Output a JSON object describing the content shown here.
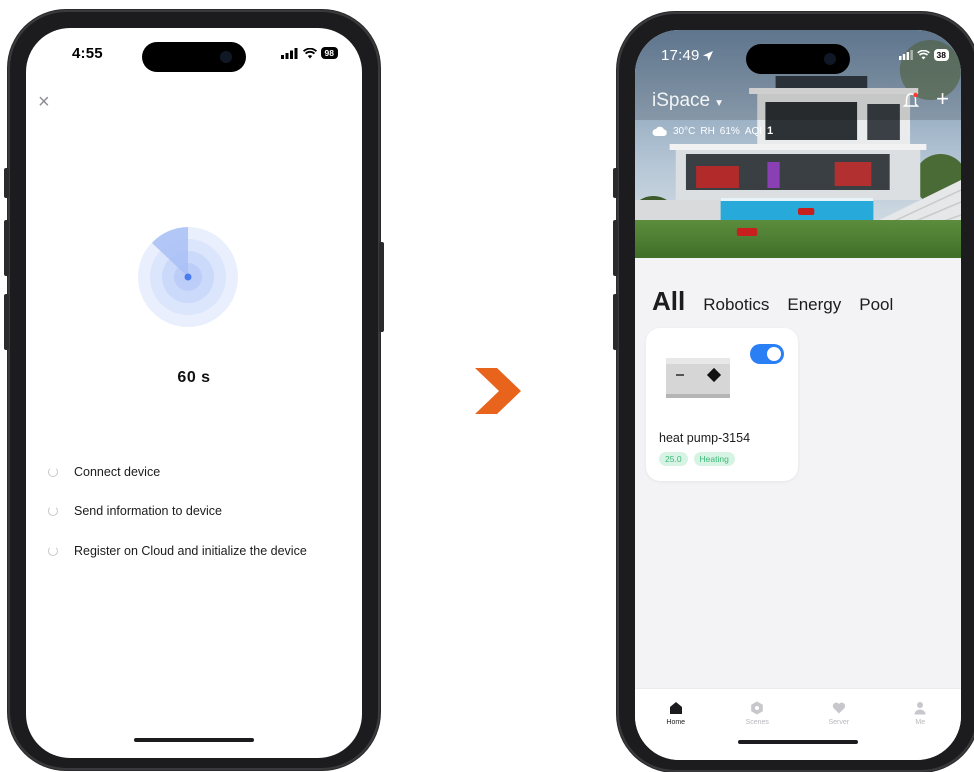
{
  "left_phone": {
    "status": {
      "time": "4:55",
      "battery": "98"
    },
    "close_symbol": "×",
    "countdown": "60 s",
    "steps": [
      {
        "label": "Connect device"
      },
      {
        "label": "Send information to device"
      },
      {
        "label": "Register on Cloud and initialize the device"
      }
    ]
  },
  "arrow_color": "#e8631c",
  "right_phone": {
    "status": {
      "time": "17:49",
      "battery": "38"
    },
    "space_title": "iSpace",
    "weather": {
      "temp": "30°C",
      "rh_label": "RH",
      "rh_value": "61%",
      "aqi_label": "AQI",
      "aqi_value": "1"
    },
    "plus_symbol": "+",
    "tabs": [
      {
        "label": "All",
        "active": true
      },
      {
        "label": "Robotics"
      },
      {
        "label": "Energy"
      },
      {
        "label": "Pool"
      }
    ],
    "device": {
      "name": "heat pump-3154",
      "toggle_on": true,
      "badges": [
        "25.0",
        "Heating"
      ]
    },
    "tabbar": [
      {
        "label": "Home",
        "icon": "home-icon",
        "active": true
      },
      {
        "label": "Scenes",
        "icon": "scenes-icon"
      },
      {
        "label": "Server",
        "icon": "heart-icon"
      },
      {
        "label": "Me",
        "icon": "person-icon"
      }
    ]
  },
  "colors": {
    "accent_blue": "#2b7ff5",
    "badge_green": "#3cb979",
    "radar_blue": "#4a7cf0"
  }
}
